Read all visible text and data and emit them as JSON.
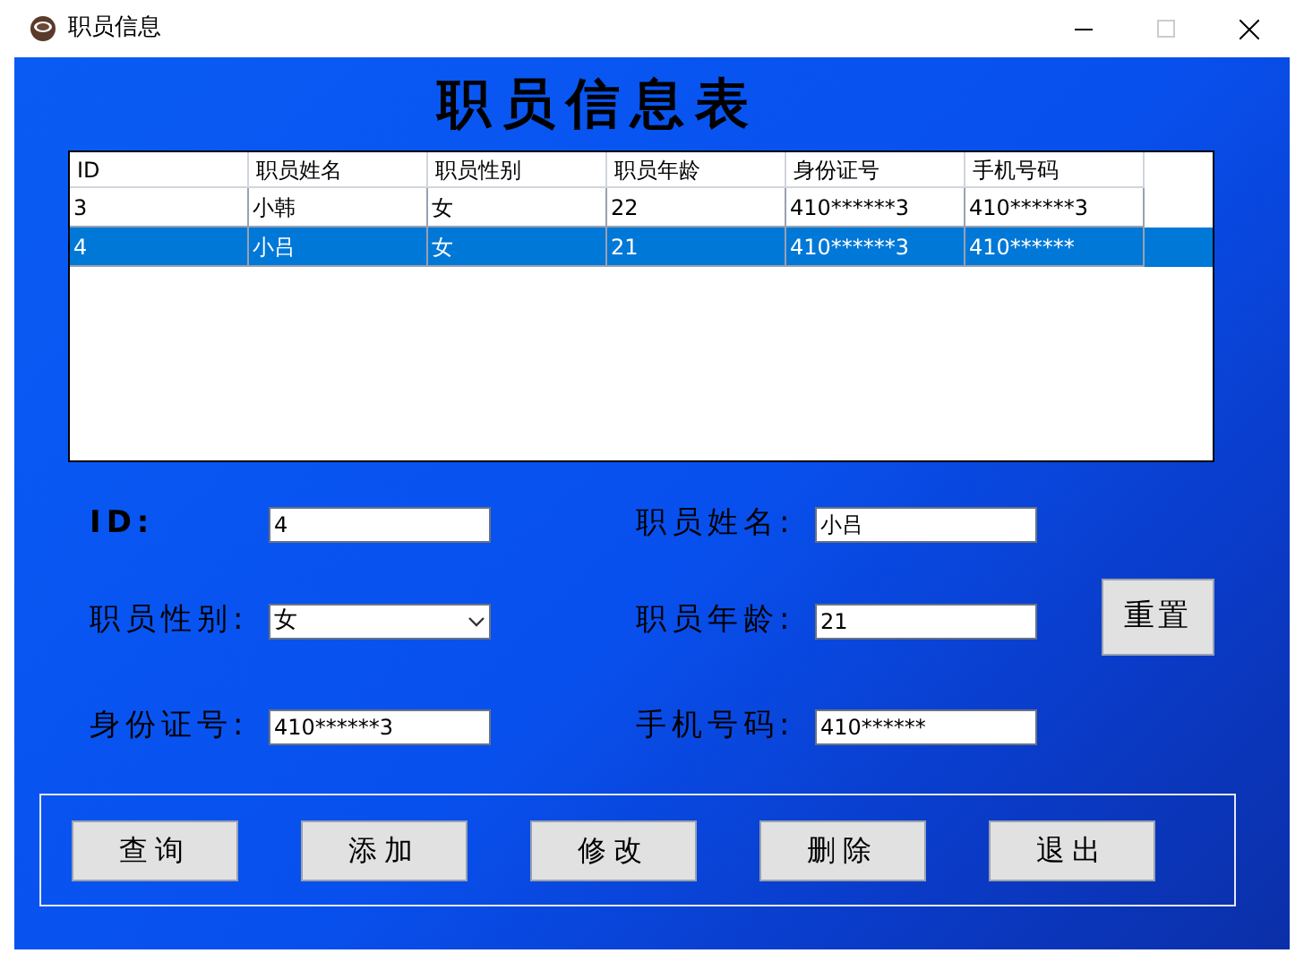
{
  "window": {
    "title": "职员信息"
  },
  "heading": "职员信息表",
  "table": {
    "columns": [
      "ID",
      "职员姓名",
      "职员性别",
      "职员年龄",
      "身份证号",
      "手机号码"
    ],
    "rows": [
      {
        "cells": [
          "3",
          "小韩",
          "女",
          "22",
          "410******3",
          "410******3"
        ],
        "selected": false
      },
      {
        "cells": [
          "4",
          "小吕",
          "女",
          "21",
          "410******3",
          "410******"
        ],
        "selected": true
      }
    ]
  },
  "form": {
    "fields": [
      {
        "label": "ID:",
        "value": "4",
        "kind": "text"
      },
      {
        "label": "职员姓名:",
        "value": "小吕",
        "kind": "text"
      },
      {
        "label": "职员性别:",
        "value": "女",
        "kind": "select"
      },
      {
        "label": "职员年龄:",
        "value": "21",
        "kind": "text"
      },
      {
        "label": "身份证号:",
        "value": "410******3",
        "kind": "text"
      },
      {
        "label": "手机号码:",
        "value": "410******",
        "kind": "text"
      }
    ],
    "reset_button": "重置"
  },
  "buttons": [
    "查询",
    "添加",
    "修改",
    "删除",
    "退出"
  ]
}
